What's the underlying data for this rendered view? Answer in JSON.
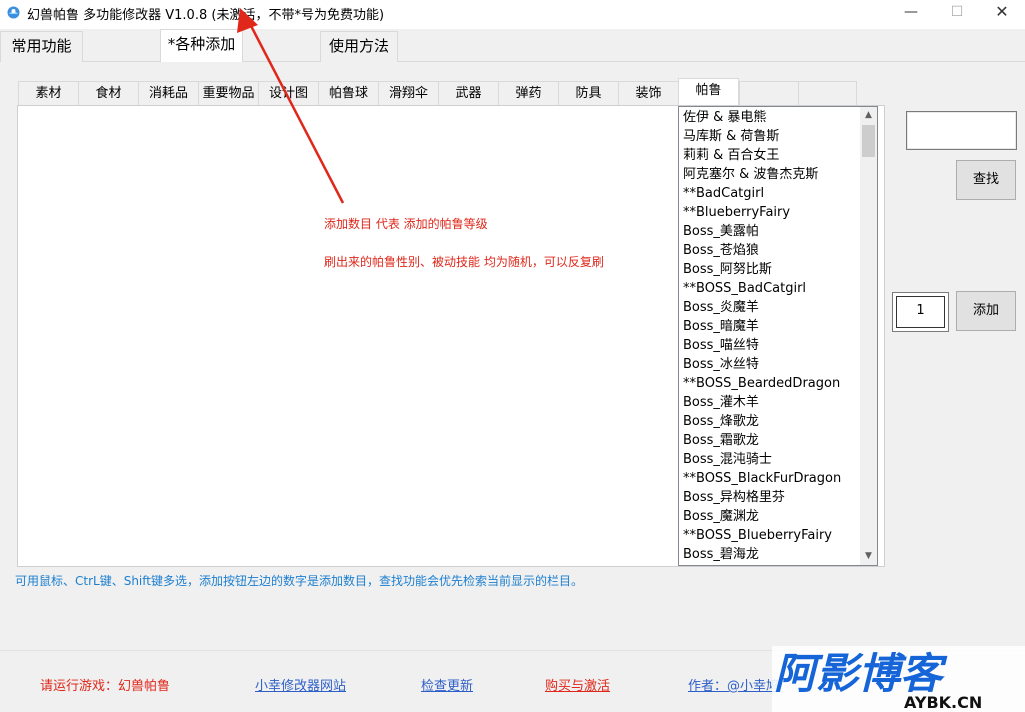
{
  "window": {
    "title": "幻兽帕鲁 多功能修改器  V1.0.8  (未激活，不带*号为免费功能)",
    "min_glyph": "—",
    "max_glyph": "☐",
    "close_glyph": "✕"
  },
  "main_tabs": [
    "常用功能",
    "*各种添加",
    "使用方法"
  ],
  "sub_tabs": [
    "素材",
    "食材",
    "消耗品",
    "重要物品",
    "设计图",
    "帕鲁球",
    "滑翔伞",
    "武器",
    "弹药",
    "防具",
    "装饰",
    "帕鲁",
    ""
  ],
  "notes": {
    "line1": "添加数目 代表 添加的帕鲁等级",
    "line2": "刷出来的帕鲁性别、被动技能 均为随机，可以反复刷"
  },
  "pal_list": [
    "佐伊 & 暴电熊",
    "马库斯 & 荷鲁斯",
    "莉莉 & 百合女王",
    "阿克塞尔 & 波鲁杰克斯",
    "**BadCatgirl",
    "**BlueberryFairy",
    "Boss_美露帕",
    "Boss_苍焰狼",
    "Boss_阿努比斯",
    "**BOSS_BadCatgirl",
    "Boss_炎魔羊",
    "Boss_暗魔羊",
    "Boss_喵丝特",
    "Boss_冰丝特",
    "**BOSS_BeardedDragon",
    "Boss_灌木羊",
    "Boss_烽歌龙",
    "Boss_霜歌龙",
    "Boss_混沌骑士",
    "**BOSS_BlackFurDragon",
    "Boss_异构格里芬",
    "Boss_魔渊龙",
    "**BOSS_BlueberryFairy",
    "Boss_碧海龙"
  ],
  "controls": {
    "search_value": "",
    "find_label": "查找",
    "count_value": "1",
    "add_label": "添加"
  },
  "hint": "可用鼠标、CtrL键、Shift键多选，添加按钮左边的数字是添加数目，查找功能会优先检索当前显示的栏目。",
  "footer": {
    "run_game": "请运行游戏：幻兽帕鲁",
    "site_link": "小幸修改器网站",
    "update_link": "检查更新",
    "buy_link": "购买与激活",
    "author": "作者：@小幸鸠"
  },
  "watermark": {
    "big": "阿影博客",
    "small": "AYBK.CN"
  },
  "colors": {
    "note_red": "#e0271a",
    "hint_blue": "#1c7fd0",
    "link_blue": "#2e5fc7",
    "watermark_blue": "#1565d8"
  }
}
